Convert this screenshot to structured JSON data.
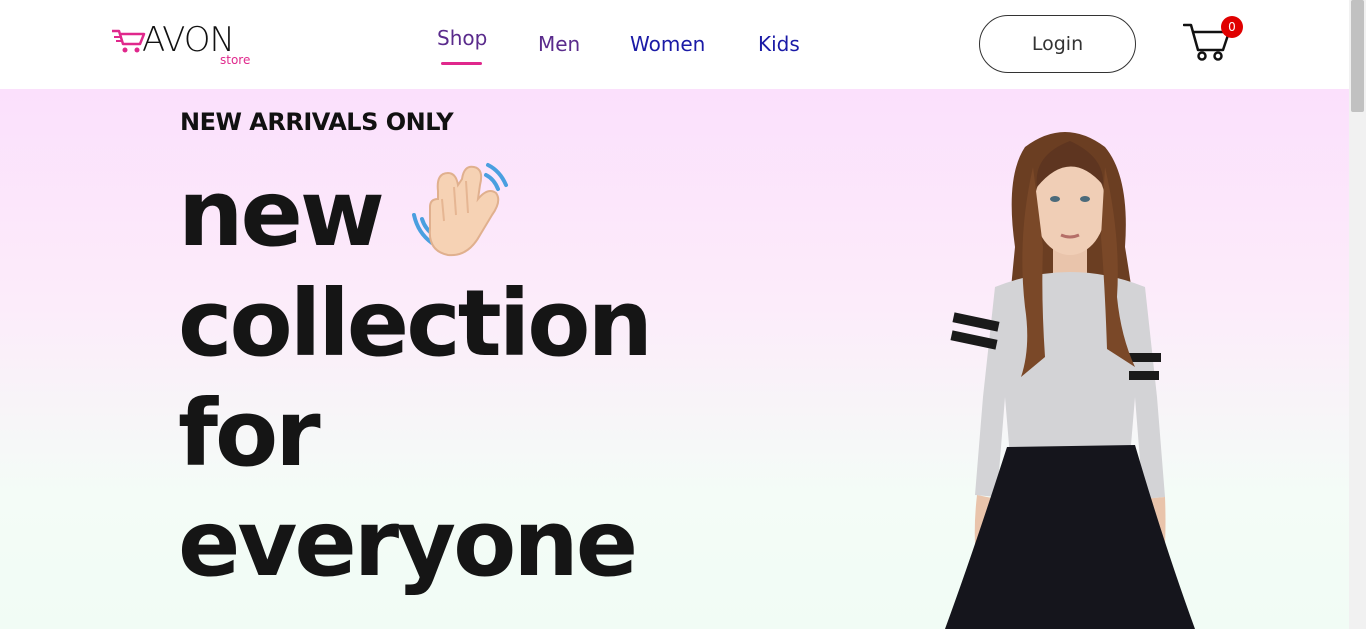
{
  "brand": {
    "name": "AVON",
    "sub": "store",
    "accent_color": "#e0288c"
  },
  "nav": {
    "links": [
      {
        "label": "Shop",
        "active": true
      },
      {
        "label": "Men"
      },
      {
        "label": "Women"
      },
      {
        "label": "Kids"
      }
    ],
    "login_label": "Login",
    "cart_count": "0"
  },
  "hero": {
    "eyebrow": "NEW ARRIVALS ONLY",
    "headline_lines": [
      "new",
      "collection",
      "for",
      "everyone"
    ],
    "emoji_icon": "waving-hand-icon",
    "image_icon": "model-photo"
  },
  "colors": {
    "badge": "#e00000",
    "hero_top": "#fbe0fc",
    "hero_bottom": "#f1fcf5"
  }
}
